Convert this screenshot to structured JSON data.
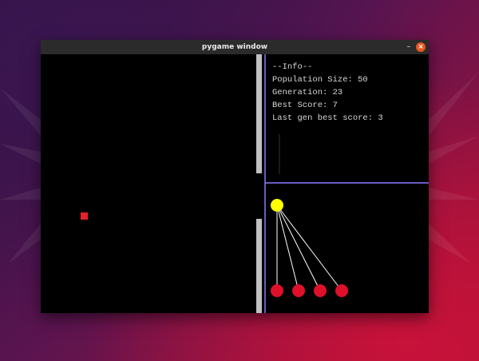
{
  "window": {
    "title": "pygame window",
    "minimize_label": "–",
    "close_label": "×"
  },
  "info": {
    "heading": "--Info--",
    "lines": [
      "Population Size: 50",
      "Generation: 23",
      "Best Score: 7",
      "Last gen best score: 3"
    ]
  },
  "colors": {
    "background": "#000000",
    "pipe": "#c0c0c0",
    "divider": "#8a7cff",
    "player": "#e8202e",
    "input_node": "#ffff00",
    "output_node": "#e0102a",
    "connection": "#ffffff",
    "text": "#d8d8d8"
  }
}
